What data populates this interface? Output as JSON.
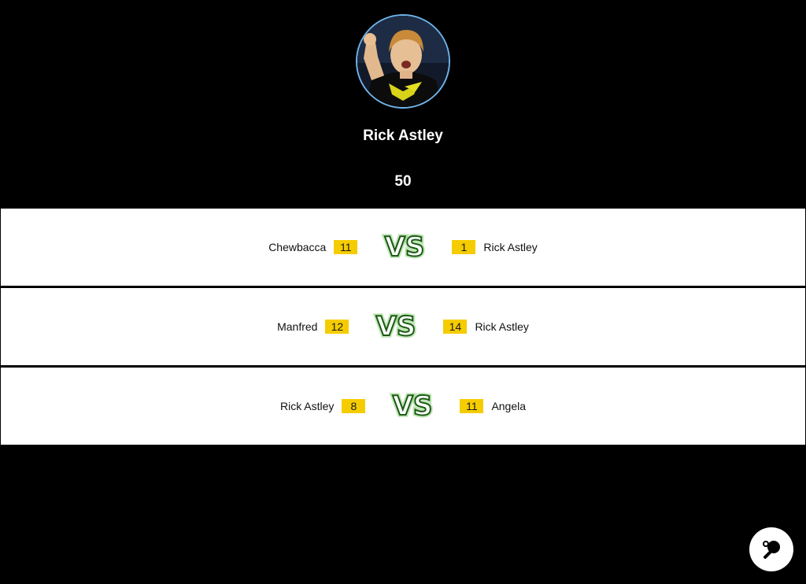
{
  "player": {
    "name": "Rick Astley",
    "score": "50",
    "avatar_icon": "player-photo"
  },
  "vs_text": "VS",
  "matches": [
    {
      "left_name": "Chewbacca",
      "left_score": "11",
      "right_score": "1",
      "right_name": "Rick Astley"
    },
    {
      "left_name": "Manfred",
      "left_score": "12",
      "right_score": "14",
      "right_name": "Rick Astley"
    },
    {
      "left_name": "Rick Astley",
      "left_score": "8",
      "right_score": "11",
      "right_name": "Angela"
    }
  ],
  "fab": {
    "icon": "ping-pong-paddle-icon"
  },
  "colors": {
    "background": "#000000",
    "score_badge": "#f5cc00",
    "avatar_ring": "#6fb3ea",
    "vs_glow": "#3a9a2a"
  }
}
